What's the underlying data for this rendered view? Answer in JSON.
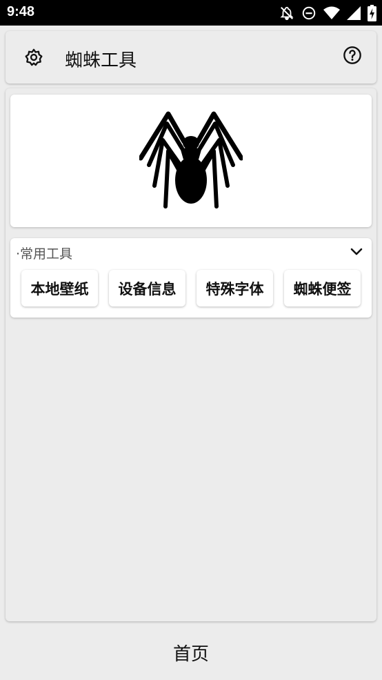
{
  "status_bar": {
    "time": "9:48",
    "icons": [
      "notifications-off-icon",
      "do-not-disturb-icon",
      "wifi-icon",
      "signal-icon",
      "battery-charging-icon"
    ]
  },
  "header": {
    "title": "蜘蛛工具",
    "left_icon": "gear-icon",
    "right_icon": "help-icon"
  },
  "hero": {
    "image": "spider-logo"
  },
  "common_tools": {
    "title": "·常用工具",
    "expand_icon": "chevron-down-icon",
    "buttons": [
      {
        "label": "本地壁纸"
      },
      {
        "label": "设备信息"
      },
      {
        "label": "特殊字体"
      },
      {
        "label": "蜘蛛便签"
      }
    ]
  },
  "bottom_nav": {
    "tabs": [
      {
        "label": "首页"
      }
    ]
  },
  "colors": {
    "background": "#ececec",
    "card": "#ffffff",
    "status_bar": "#000000",
    "text": "#111111"
  }
}
